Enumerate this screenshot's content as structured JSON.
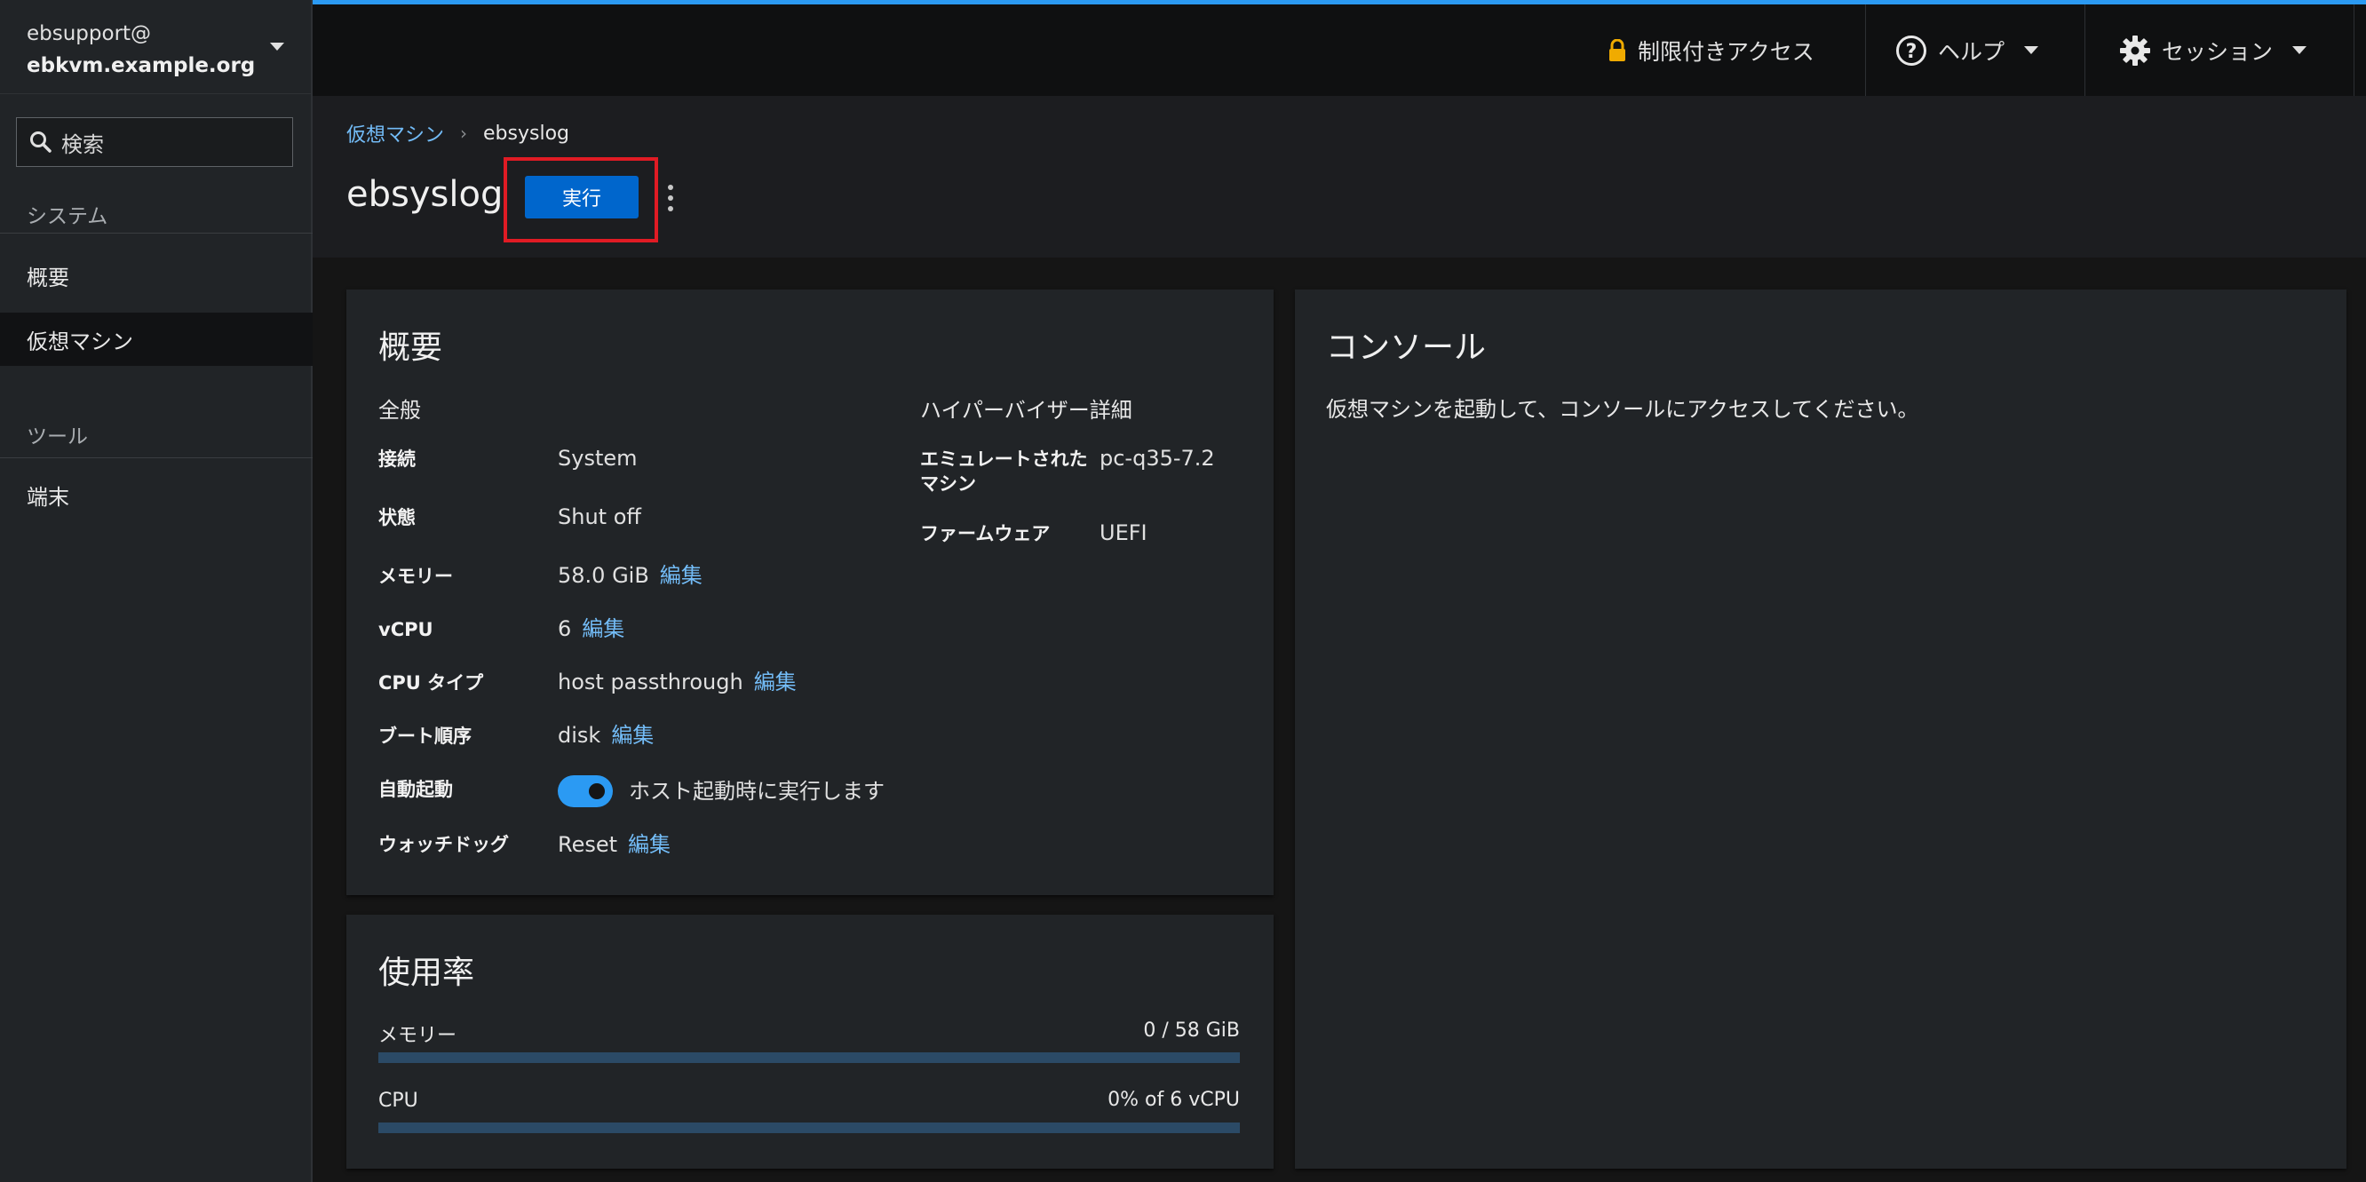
{
  "host": {
    "user": "ebsupport@",
    "name": "ebkvm.example.org"
  },
  "sidebar": {
    "search_placeholder": "検索",
    "sections": [
      {
        "title": "システム",
        "items": [
          {
            "label": "概要",
            "active": false
          },
          {
            "label": "仮想マシン",
            "active": true
          }
        ]
      },
      {
        "title": "ツール",
        "items": [
          {
            "label": "端末",
            "active": false
          }
        ]
      }
    ]
  },
  "topbar": {
    "access": "制限付きアクセス",
    "help": "ヘルプ",
    "session": "セッション",
    "accent_color": "#2b9af3"
  },
  "breadcrumb": {
    "parent": "仮想マシン",
    "current": "ebsyslog"
  },
  "vm": {
    "name": "ebsyslog",
    "run_label": "実行"
  },
  "overview": {
    "title": "概要",
    "general_heading": "全般",
    "hypervisor_heading": "ハイパーバイザー詳細",
    "connection": {
      "label": "接続",
      "value": "System"
    },
    "state": {
      "label": "状態",
      "value": "Shut off"
    },
    "memory": {
      "label": "メモリー",
      "value": "58.0 GiB",
      "edit": "編集"
    },
    "vcpu": {
      "label": "vCPU",
      "value": "6",
      "edit": "編集"
    },
    "cpu_type": {
      "label": "CPU タイプ",
      "value": "host passthrough",
      "edit": "編集"
    },
    "boot_order": {
      "label": "ブート順序",
      "value": "disk",
      "edit": "編集"
    },
    "autostart": {
      "label": "自動起動",
      "value": "ホスト起動時に実行します",
      "enabled": true
    },
    "watchdog": {
      "label": "ウォッチドッグ",
      "value": "Reset",
      "edit": "編集"
    },
    "emulated_machine": {
      "label_line1": "エミュレートされた",
      "label_line2": "マシン",
      "value": "pc-q35-7.2"
    },
    "firmware": {
      "label": "ファームウェア",
      "value": "UEFI"
    }
  },
  "usage": {
    "title": "使用率",
    "memory": {
      "label": "メモリー",
      "value": "0 / 58 GiB",
      "fraction": 0
    },
    "cpu": {
      "label": "CPU",
      "value": "0% of 6 vCPU",
      "fraction": 0
    }
  },
  "console": {
    "title": "コンソール",
    "message": "仮想マシンを起動して、コンソールにアクセスしてください。"
  }
}
